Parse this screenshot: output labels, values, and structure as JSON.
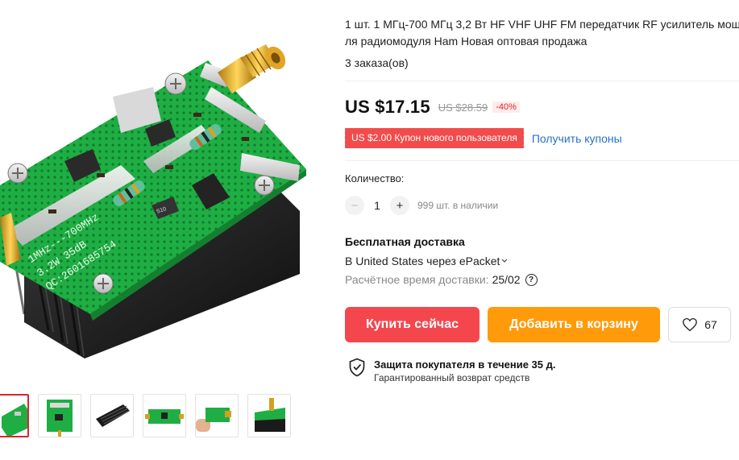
{
  "product": {
    "title_line1": "1 шт. 1 МГц-700 МГц 3,2 Вт HF VHF UHF FM передатчик RF усилитель мощности",
    "title_line2": "ля радиомодуля Ham Новая оптовая продажа",
    "orders": "3 заказа(ов)"
  },
  "pcb_labels": {
    "freq": "1MHz---700MHz",
    "spec": "3.2W 35dB",
    "code": "QC:2601685754",
    "chip": "S10"
  },
  "price": {
    "current": "US $17.15",
    "original": "US $28.59",
    "discount": "-40%"
  },
  "coupon": {
    "label": "US $2.00 Купон нового пользователя",
    "link": "Получить купоны"
  },
  "quantity": {
    "label": "Количество:",
    "value": "1",
    "minus": "−",
    "plus": "+",
    "stock": "999 шт. в наличии"
  },
  "shipping": {
    "title": "Бесплатная доставка",
    "route": "В United States через ePacket",
    "time_label": "Расчётное время доставки:",
    "time_value": "25/02",
    "help": "?"
  },
  "actions": {
    "buy_now": "Купить сейчас",
    "add_to_cart": "Добавить в корзину",
    "wishlist_count": "67"
  },
  "protection": {
    "title": "Защита покупателя в течение 35 д.",
    "subtitle": "Гарантированный возврат средств"
  },
  "colors": {
    "accent_red": "#f4474d",
    "accent_orange": "#ff9a0a",
    "link_blue": "#2671c9",
    "pcb_green": "#1fae43"
  },
  "icons": [
    "heart-icon",
    "shield-check-icon",
    "help-circle-icon",
    "chevron-down-icon"
  ],
  "thumbnails": [
    {
      "name": "pcb-angle",
      "active": true
    },
    {
      "name": "pcb-top",
      "active": false
    },
    {
      "name": "heatsink",
      "active": false
    },
    {
      "name": "pcb-flat",
      "active": false
    },
    {
      "name": "pcb-in-hand",
      "active": false
    },
    {
      "name": "pcb-side",
      "active": false
    }
  ]
}
